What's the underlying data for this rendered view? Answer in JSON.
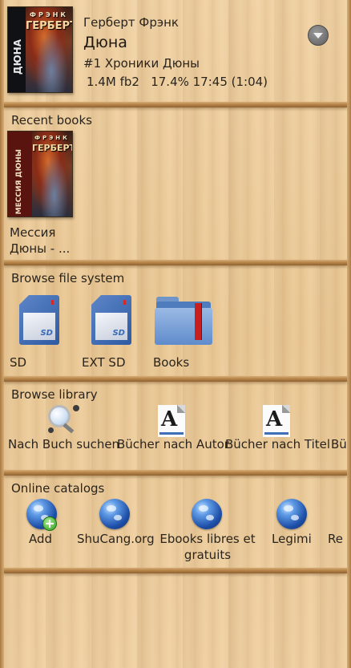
{
  "current_book": {
    "author": "Герберт Фрэнк",
    "title": "Дюна",
    "series": "#1 Хроники Дюны",
    "info": "1.4M fb2   17.4% 17:45 (1:04)",
    "cover": {
      "author": "ГЕРБЕРТ",
      "author_top": "ФРЭНК",
      "spine_title": "ДЮНА"
    }
  },
  "recent": {
    "title": "Recent books",
    "books": [
      {
        "label": "Мессия Дюны - ...",
        "cover": {
          "author": "ГЕРБЕРТ",
          "author_top": "ФРЭНК",
          "spine_title": "МЕССИЯ ДЮНЫ"
        }
      }
    ]
  },
  "filesystem": {
    "title": "Browse file system",
    "items": [
      {
        "label": "SD",
        "icon": "sd-card-icon",
        "card_text": "SD"
      },
      {
        "label": "EXT SD",
        "icon": "sd-card-icon",
        "card_text": "SD"
      },
      {
        "label": "Books",
        "icon": "folder-icon"
      }
    ]
  },
  "library": {
    "title": "Browse library",
    "items": [
      {
        "label": "Nach Buch suchen",
        "icon": "search-icon"
      },
      {
        "label": "Bücher nach Autor",
        "icon": "document-a-icon"
      },
      {
        "label": "Bücher nach Titel",
        "icon": "document-a-icon"
      },
      {
        "label": "Bü",
        "icon": "document-a-icon"
      }
    ]
  },
  "catalogs": {
    "title": "Online catalogs",
    "items": [
      {
        "label": "Add",
        "icon": "globe-add-icon"
      },
      {
        "label": "ShuCang.org",
        "icon": "globe-icon"
      },
      {
        "label": "Ebooks libres et gratuits",
        "icon": "globe-icon"
      },
      {
        "label": "Legimi",
        "icon": "globe-icon"
      },
      {
        "label": "Re",
        "icon": "globe-icon"
      }
    ]
  },
  "colors": {
    "wood": "#ebc996",
    "shelf": "#b8864a",
    "sd_blue": "#2e5aa3",
    "bookmark_red": "#c81e1e"
  }
}
